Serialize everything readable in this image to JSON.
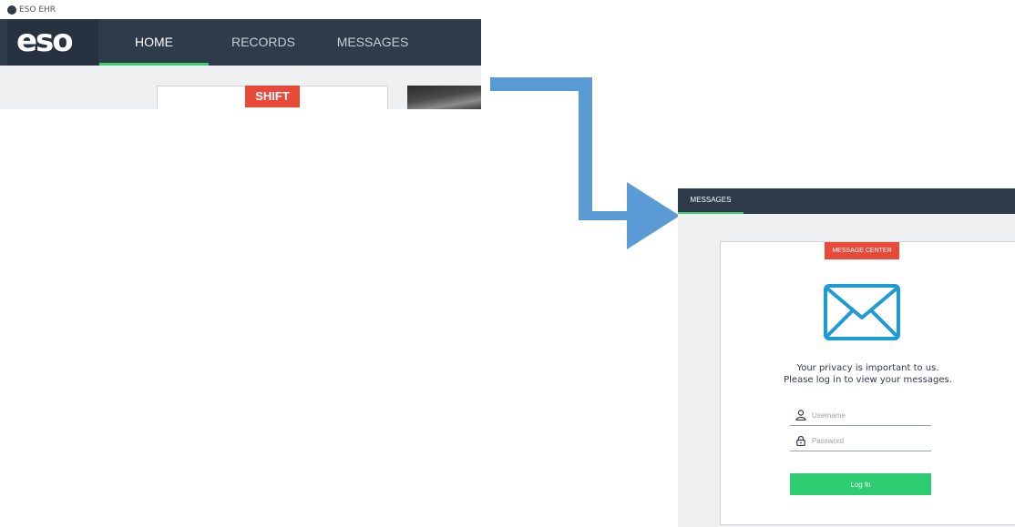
{
  "app": {
    "window_title": "ESO EHR",
    "logo_text": "eso",
    "nav_tabs": [
      {
        "label": "HOME",
        "active": true
      },
      {
        "label": "RECORDS",
        "active": false
      },
      {
        "label": "MESSAGES",
        "active": false
      }
    ],
    "shift_card": {
      "badge": "SHIFT"
    }
  },
  "messages_panel": {
    "tab": {
      "label": "MESSAGES",
      "active": true
    },
    "card": {
      "badge": "MESSAGE CENTER",
      "icon": "envelope-icon",
      "privacy_line1": "Your privacy is important to us.",
      "privacy_line2": "Please log in to view your messages.",
      "username": {
        "placeholder": "Username",
        "value": "",
        "icon": "user-icon"
      },
      "password": {
        "placeholder": "Password",
        "value": "",
        "icon": "lock-icon"
      },
      "login_button": "Log In"
    }
  },
  "colors": {
    "navbar": "#2e3b4b",
    "active_tab_underline": "#3ecf6c",
    "badge": "#e74a39",
    "login_button": "#2ecc71",
    "envelope": "#1e9ad6",
    "arrow": "#5b9bd5",
    "content_background": "#eef0f1"
  }
}
